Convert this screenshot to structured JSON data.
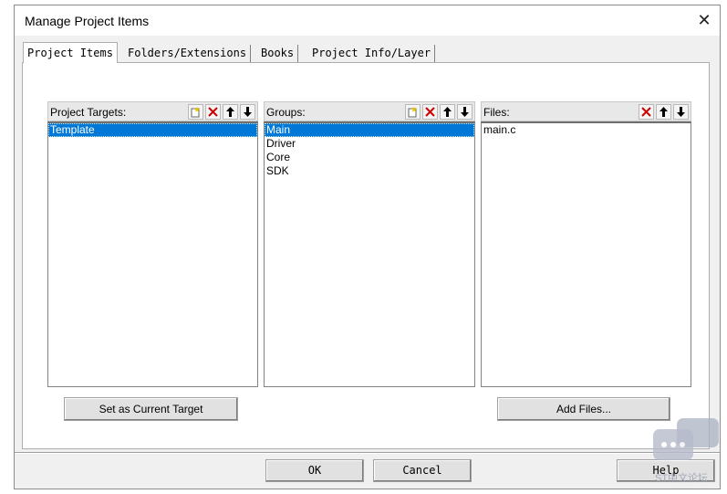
{
  "window": {
    "title": "Manage Project Items",
    "close_glyph": "✕"
  },
  "tabs": [
    {
      "label": "Project Items",
      "active": true
    },
    {
      "label": "Folders/Extensions",
      "active": false
    },
    {
      "label": "Books",
      "active": false
    },
    {
      "label": "Project Info/Layer",
      "active": false
    }
  ],
  "targets_panel": {
    "label": "Project Targets:",
    "tools": [
      "new-item-icon",
      "delete-x-icon",
      "move-up-icon",
      "move-down-icon"
    ],
    "items": [
      "Template"
    ],
    "selected_index": 0,
    "action_button": "Set as Current Target"
  },
  "groups_panel": {
    "label": "Groups:",
    "tools": [
      "new-item-icon",
      "delete-x-icon",
      "move-up-icon",
      "move-down-icon"
    ],
    "items": [
      "Main",
      "Driver",
      "Core",
      "SDK"
    ],
    "selected_index": 0
  },
  "files_panel": {
    "label": "Files:",
    "tools": [
      "delete-x-icon",
      "move-up-icon",
      "move-down-icon"
    ],
    "items": [
      "main.c"
    ],
    "action_button": "Add Files..."
  },
  "footer": {
    "ok_label": "OK",
    "cancel_label": "Cancel",
    "help_label": "Help"
  },
  "watermark": {
    "text": "ST中文论坛"
  },
  "colors": {
    "selection": "#0078d7",
    "delete_icon": "#cc0000",
    "dialog_bg": "#f0f0f0"
  }
}
